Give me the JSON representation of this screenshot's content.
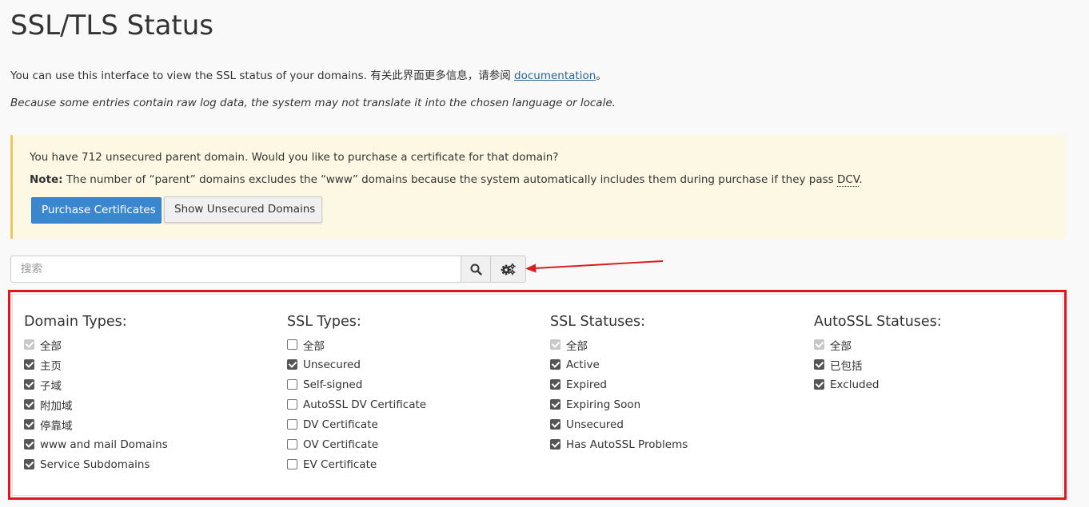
{
  "page": {
    "title": "SSL/TLS Status",
    "intro_text": "You can use this interface to view the SSL status of your domains. 有关此界面更多信息，请参阅 ",
    "intro_link": "documentation",
    "intro_end": "。",
    "note_italic": "Because some entries contain raw log data, the system may not translate it into the chosen language or locale."
  },
  "alert": {
    "line1": "You have 712 unsecured parent domain. Would you like to purchase a certificate for that domain?",
    "note_label": "Note:",
    "note_text": " The number of “parent” domains excludes the “www” domains because the system automatically includes them during purchase if they pass ",
    "note_abbr": "DCV",
    "note_end": ".",
    "purchase_button": "Purchase Certificates",
    "show_unsecured_button": "Show Unsecured Domains"
  },
  "search": {
    "placeholder": "搜索",
    "value": ""
  },
  "icons": {
    "search": "search-icon",
    "settings": "gears-icon",
    "arrow": "red-arrow-annotation"
  },
  "colors": {
    "primary": "#3a87cf",
    "alert_bg": "#fdf8e4",
    "alert_border": "#f0c75e",
    "highlight": "#e3141a",
    "link": "#2a6496"
  },
  "filters": {
    "domain_types": {
      "heading": "Domain Types:",
      "items": [
        {
          "label": "全部",
          "state": "disabled"
        },
        {
          "label": "主页",
          "state": "checked"
        },
        {
          "label": "子域",
          "state": "checked"
        },
        {
          "label": "附加域",
          "state": "checked"
        },
        {
          "label": "停靠域",
          "state": "checked"
        },
        {
          "label": "www and mail Domains",
          "state": "checked"
        },
        {
          "label": "Service Subdomains",
          "state": "checked"
        }
      ]
    },
    "ssl_types": {
      "heading": "SSL Types:",
      "items": [
        {
          "label": "全部",
          "state": "unchecked"
        },
        {
          "label": "Unsecured",
          "state": "checked"
        },
        {
          "label": "Self-signed",
          "state": "unchecked"
        },
        {
          "label": "AutoSSL DV Certificate",
          "state": "unchecked"
        },
        {
          "label": "DV Certificate",
          "state": "unchecked"
        },
        {
          "label": "OV Certificate",
          "state": "unchecked"
        },
        {
          "label": "EV Certificate",
          "state": "unchecked"
        }
      ]
    },
    "ssl_statuses": {
      "heading": "SSL Statuses:",
      "items": [
        {
          "label": "全部",
          "state": "disabled"
        },
        {
          "label": "Active",
          "state": "checked"
        },
        {
          "label": "Expired",
          "state": "checked"
        },
        {
          "label": "Expiring Soon",
          "state": "checked"
        },
        {
          "label": "Unsecured",
          "state": "checked"
        },
        {
          "label": "Has AutoSSL Problems",
          "state": "checked"
        }
      ]
    },
    "autossl_statuses": {
      "heading": "AutoSSL Statuses:",
      "items": [
        {
          "label": "全部",
          "state": "disabled"
        },
        {
          "label": "已包括",
          "state": "checked"
        },
        {
          "label": "Excluded",
          "state": "checked"
        }
      ]
    }
  }
}
